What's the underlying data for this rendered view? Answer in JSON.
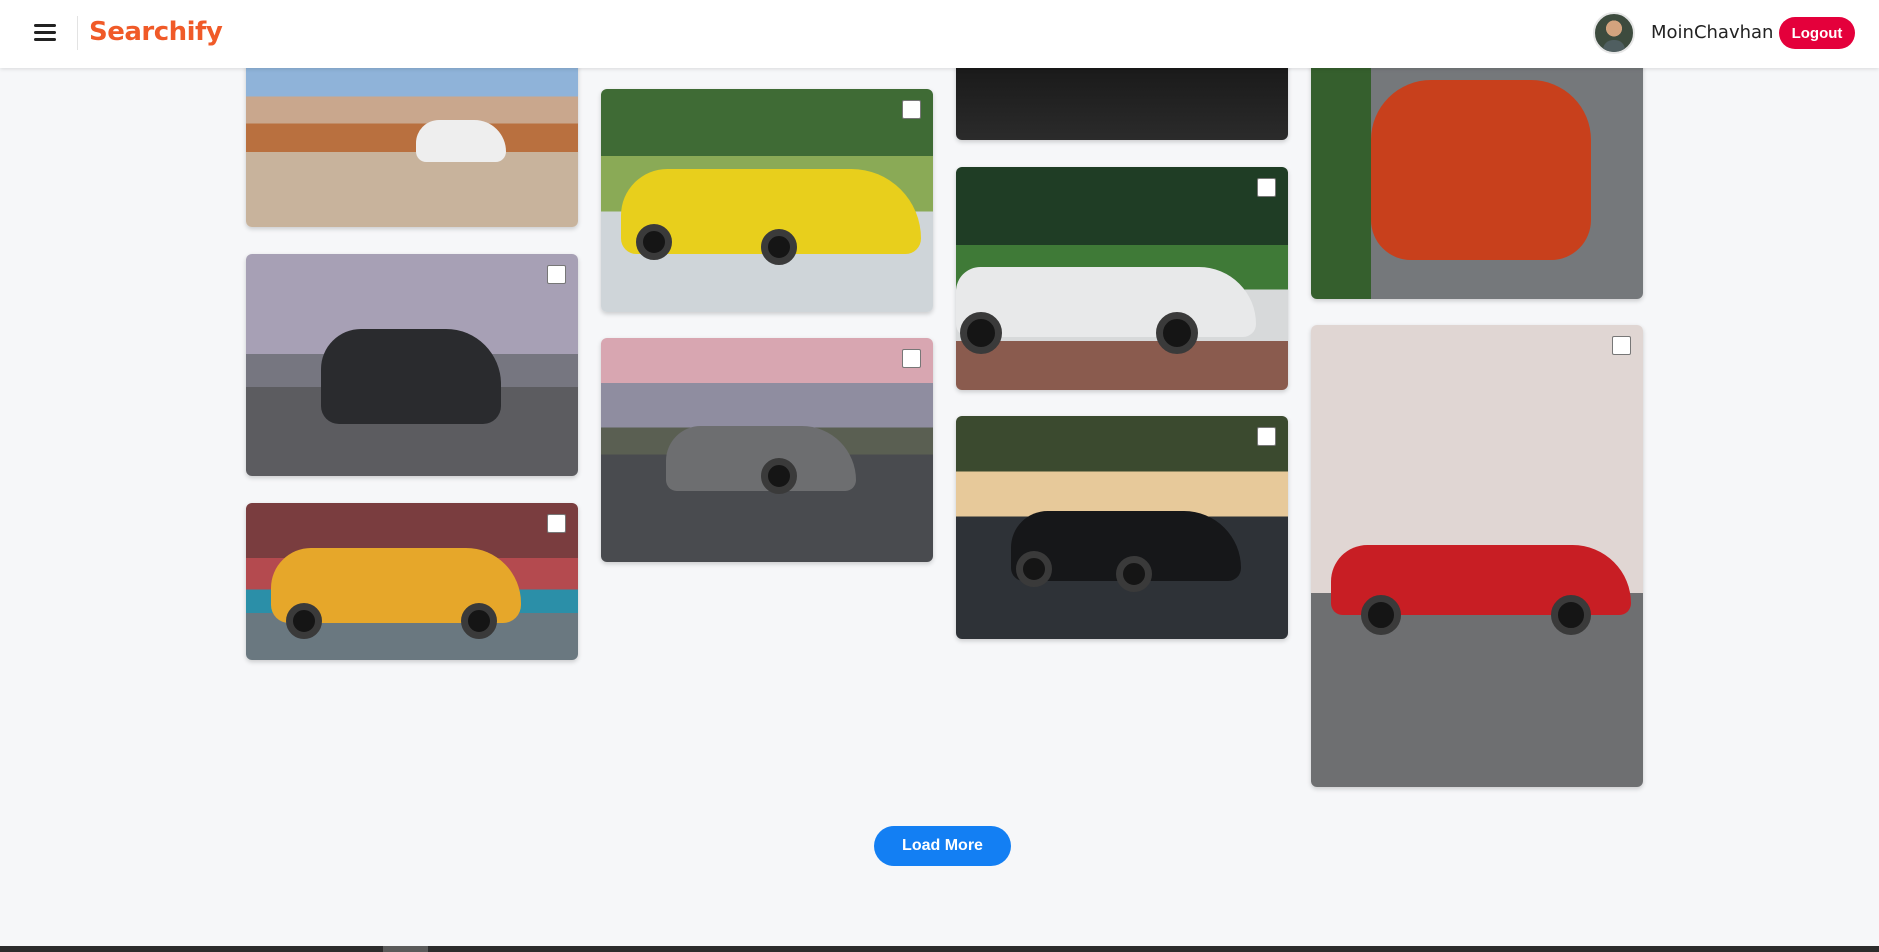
{
  "header": {
    "brand": "Searchify",
    "menu_icon": "hamburger-menu-icon",
    "user": {
      "name": "MoinChavhan",
      "avatar_icon": "user-avatar-icon"
    },
    "logout_label": "Logout"
  },
  "gallery": {
    "cards": [
      {
        "subject": "white-suv-desert",
        "selected": false
      },
      {
        "subject": "black-mustang-road",
        "selected": false
      },
      {
        "subject": "yellow-vintage-taxi",
        "selected": false
      },
      {
        "subject": "yellow-lamborghini",
        "selected": false
      },
      {
        "subject": "grey-audi-r8",
        "selected": false
      },
      {
        "subject": "dark-car-partial",
        "selected": false
      },
      {
        "subject": "white-convertible",
        "selected": false
      },
      {
        "subject": "black-mustang-sunset",
        "selected": false
      },
      {
        "subject": "orange-bmw-m4",
        "selected": false
      },
      {
        "subject": "red-jaguar-building",
        "selected": false
      }
    ],
    "load_more_label": "Load More"
  },
  "colors": {
    "brand": "#f05a28",
    "logout": "#e4003b",
    "load_more": "#137ff3",
    "background": "#f6f7f9"
  }
}
